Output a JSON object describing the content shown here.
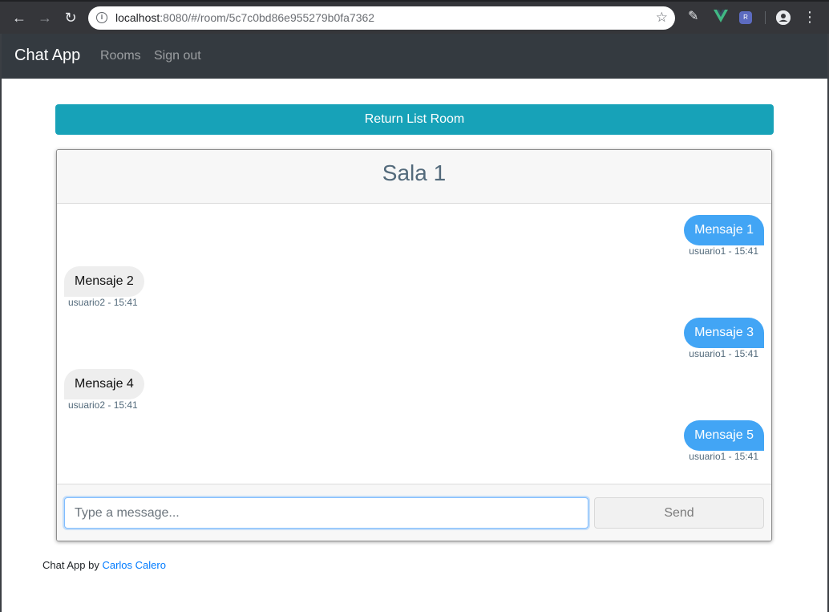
{
  "browser": {
    "url_host": "localhost",
    "url_path": ":8080/#/room/5c7c0bd86e955279b0fa7362",
    "icons": [
      "back-arrow-icon",
      "forward-arrow-icon",
      "reload-icon",
      "info-icon",
      "star-icon",
      "gnome-extension-icon",
      "vue-devtools-icon",
      "redux-devtools-icon",
      "account-icon",
      "menu-dots-icon"
    ]
  },
  "navbar": {
    "brand": "Chat App",
    "links": [
      "Rooms",
      "Sign out"
    ]
  },
  "return_button": "Return List Room",
  "room": {
    "title": "Sala 1",
    "messages": [
      {
        "text": "Mensaje 1",
        "meta": "usuario1 - 15:41",
        "own": true
      },
      {
        "text": "Mensaje 2",
        "meta": "usuario2 - 15:41",
        "own": false
      },
      {
        "text": "Mensaje 3",
        "meta": "usuario1 - 15:41",
        "own": true
      },
      {
        "text": "Mensaje 4",
        "meta": "usuario2 - 15:41",
        "own": false
      },
      {
        "text": "Mensaje 5",
        "meta": "usuario1 - 15:41",
        "own": true
      }
    ]
  },
  "composer": {
    "placeholder": "Type a message...",
    "value": "",
    "send_label": "Send"
  },
  "footer": {
    "prefix": "Chat App by",
    "author": "Carlos Calero"
  },
  "colors": {
    "navbar": "#343a40",
    "return_button": "#17a2b8",
    "own_bubble": "#42a5f5",
    "other_bubble": "#eeeeee",
    "link": "#007bff"
  }
}
